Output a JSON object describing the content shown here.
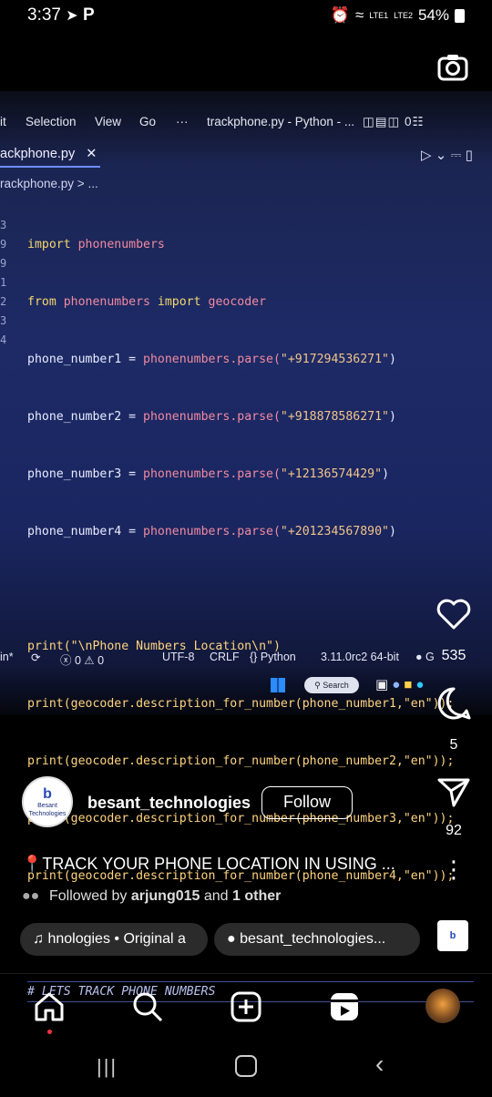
{
  "status_bar": {
    "time": "3:37",
    "battery": "54%",
    "net1": "LTE1",
    "net2": "LTE2"
  },
  "editor": {
    "menu": [
      "it",
      "Selection",
      "View",
      "Go",
      "···",
      "trackphone.py - Python - ..."
    ],
    "tab": "ackphone.py",
    "tab_close": "✕",
    "breadcrumb": "rackphone.py > ...",
    "line_numbers": [
      "",
      "",
      "",
      "",
      "",
      "",
      "3",
      "9",
      "9",
      "1",
      "2",
      "3",
      "4"
    ],
    "lines": [
      {
        "a": "import",
        "b": " phonenumbers"
      },
      {
        "a": "from",
        "b": " phonenumbers ",
        "c": "import",
        "d": " geocoder"
      },
      {
        "v": "phone_number1 = ",
        "f": "phonenumbers.parse(",
        "s": "\"+917294536271\"",
        "e": ")"
      },
      {
        "v": "phone_number2 = ",
        "f": "phonenumbers.parse(",
        "s": "\"+918878586271\"",
        "e": ")"
      },
      {
        "v": "phone_number3 = ",
        "f": "phonenumbers.parse(",
        "s": "\"+12136574429\"",
        "e": ")"
      },
      {
        "v": "phone_number4 = ",
        "f": "phonenumbers.parse(",
        "s": "\"+201234567890\"",
        "e": ")"
      },
      {
        "p": "print(\"\\nPhone Numbers Location\\n\")"
      },
      {
        "p": "print(geocoder.description_for_number(phone_number1,\"en\"));"
      },
      {
        "p": "print(geocoder.description_for_number(phone_number2,\"en\"));"
      },
      {
        "p": "print(geocoder.description_for_number(phone_number3,\"en\"));"
      },
      {
        "p": "print(geocoder.description_for_number(phone_number4,\"en\"));"
      },
      {
        "c": "# LETS TRACK PHONE NUMBERS"
      }
    ],
    "statusbar": {
      "left": "in*",
      "errors": "ⓧ 0 ⚠ 0",
      "encoding": "UTF-8",
      "eol": "CRLF",
      "lang": "{} Python",
      "version": "3.11.0rc2 64-bit"
    },
    "taskbar_search": "Search"
  },
  "rail": {
    "likes": "535",
    "comments": "5",
    "shares": "92"
  },
  "post": {
    "username": "besant_technologies",
    "follow": "Follow",
    "avatar_text": "Besant Technologies",
    "caption": "📍TRACK YOUR PHONE LOCATION IN USING ...",
    "followed_prefix": "Followed by ",
    "followed_user": "arjung015",
    "followed_mid": " and ",
    "followed_rest": "1 other",
    "audio": "hnologies • Original a",
    "tagged": "besant_technologies..."
  },
  "colors": {
    "accent_line": "#6e8cff",
    "follow_border": "#ffffff",
    "notif_dot": "#ff3040"
  }
}
